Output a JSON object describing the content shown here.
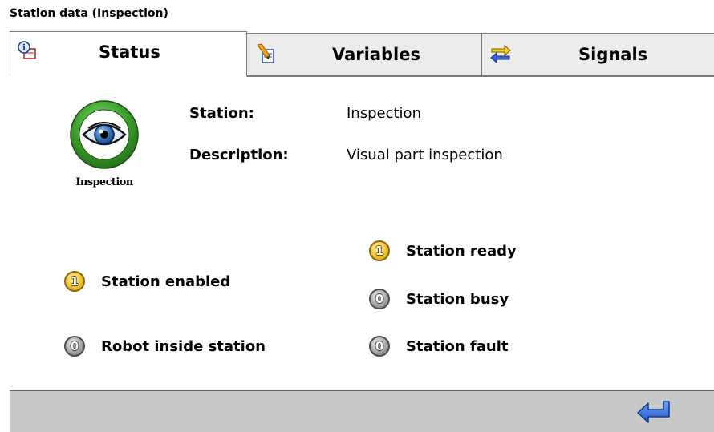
{
  "window": {
    "title": "Station data (Inspection)"
  },
  "tabs": [
    {
      "label": "Status",
      "icon": "info-icon",
      "active": true
    },
    {
      "label": "Variables",
      "icon": "variables-icon",
      "active": false
    },
    {
      "label": "Signals",
      "icon": "signals-icon",
      "active": false
    }
  ],
  "station": {
    "icon": "eye-icon",
    "icon_label": "Inspection",
    "station_label": "Station:",
    "station_value": "Inspection",
    "description_label": "Description:",
    "description_value": "Visual part inspection"
  },
  "indicators": {
    "station_enabled": {
      "label": "Station enabled",
      "value": "1"
    },
    "robot_inside": {
      "label": "Robot inside station",
      "value": "0"
    },
    "station_ready": {
      "label": "Station ready",
      "value": "1"
    },
    "station_busy": {
      "label": "Station busy",
      "value": "0"
    },
    "station_fault": {
      "label": "Station fault",
      "value": "0"
    }
  },
  "footer": {
    "enter_icon": "enter-arrow-icon"
  },
  "colors": {
    "indicator_on": "#f1c232",
    "indicator_off": "#a7a7a7",
    "ring_green": "#3a9b2a",
    "footer_bg": "#c8c8c8",
    "enter_blue": "#2f6fd6"
  }
}
